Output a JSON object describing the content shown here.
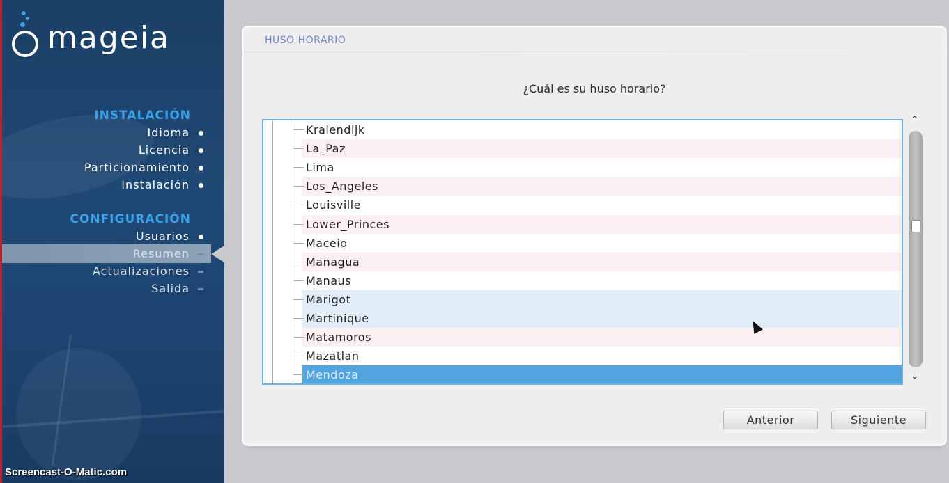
{
  "sidebar": {
    "logo_text": "mageia",
    "sections": [
      {
        "title": "INSTALACIÓN",
        "items": [
          {
            "label": "Idioma",
            "state": "done"
          },
          {
            "label": "Licencia",
            "state": "done"
          },
          {
            "label": "Particionamiento",
            "state": "done"
          },
          {
            "label": "Instalación",
            "state": "done"
          }
        ]
      },
      {
        "title": "CONFIGURACIÓN",
        "items": [
          {
            "label": "Usuarios",
            "state": "done"
          },
          {
            "label": "Resumen",
            "state": "active"
          },
          {
            "label": "Actualizaciones",
            "state": "pending"
          },
          {
            "label": "Salida",
            "state": "pending"
          }
        ]
      }
    ],
    "watermark": "Screencast-O-Matic.com"
  },
  "main": {
    "header": "HUSO HORARIO",
    "question": "¿Cuál es su huso horario?",
    "timezones": [
      "Kralendijk",
      "La_Paz",
      "Lima",
      "Los_Angeles",
      "Louisville",
      "Lower_Princes",
      "Maceio",
      "Managua",
      "Manaus",
      "Marigot",
      "Martinique",
      "Matamoros",
      "Mazatlan",
      "Mendoza"
    ],
    "hover_index": 9,
    "hover2_index": 10,
    "selected": "Mendoza",
    "buttons": {
      "previous": "Anterior",
      "next": "Siguiente"
    }
  },
  "colors": {
    "sidebar_bg": "#1f4874",
    "accent": "#3aa2ea",
    "selection": "#52a4e0",
    "list_border": "#6eb2e5"
  }
}
